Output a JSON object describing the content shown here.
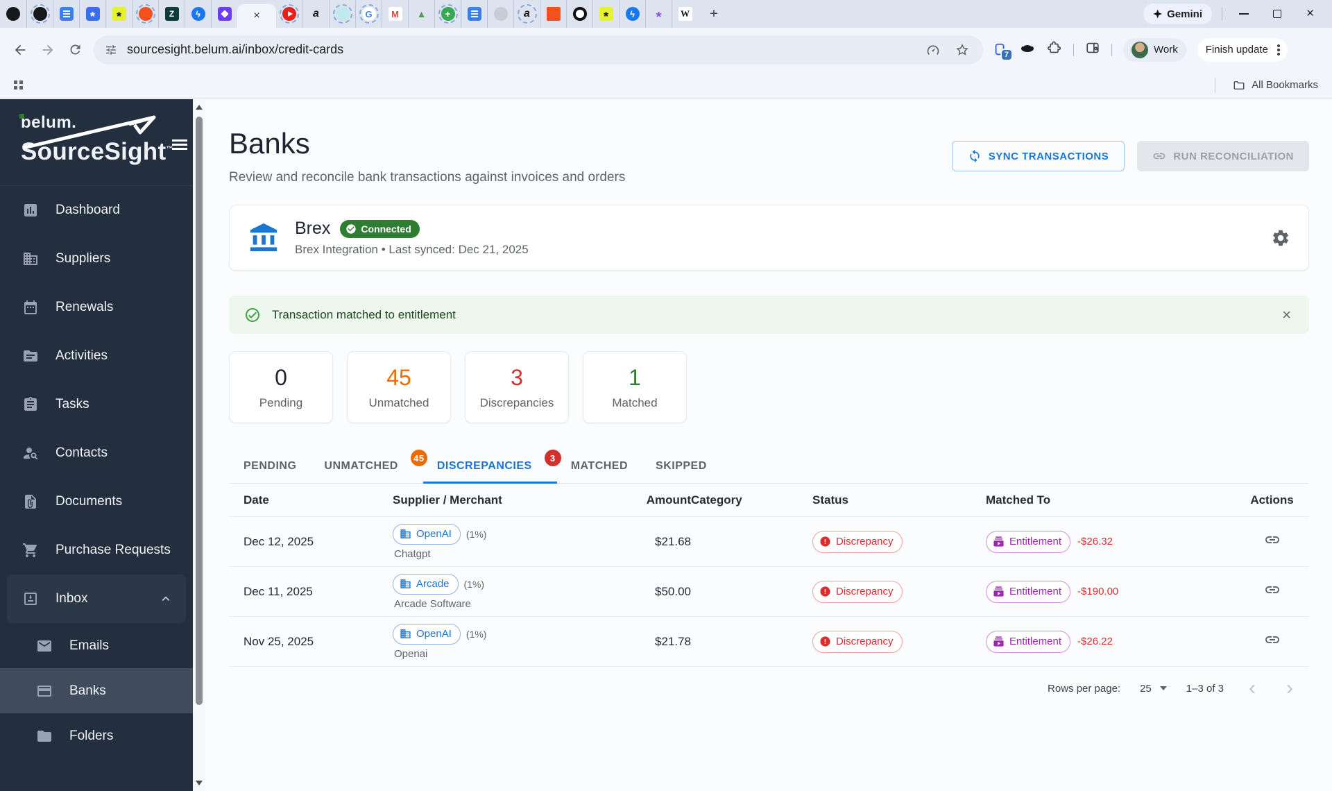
{
  "theme": {
    "accent": "#1976d2",
    "success": "#2e7d32",
    "warning": "#ed6c02",
    "error": "#d32f2f",
    "purple": "#9c27b0",
    "sidebar_bg": "#232e3e",
    "alert_bg": "#edf7ed",
    "tabstrip_bg": "#dde4f0"
  },
  "browser": {
    "url": "sourcesight.belum.ai/inbox/credit-cards",
    "gemini_label": "Gemini",
    "profile_label": "Work",
    "update_button": "Finish update",
    "extension_badge": "7",
    "bookmarks_label": "All Bookmarks"
  },
  "sidebar": {
    "brand_line1": "belum.",
    "brand_line2": "SourceSight",
    "brand_tm": "™",
    "items": [
      {
        "label": "Dashboard"
      },
      {
        "label": "Suppliers"
      },
      {
        "label": "Renewals"
      },
      {
        "label": "Activities"
      },
      {
        "label": "Tasks"
      },
      {
        "label": "Contacts"
      },
      {
        "label": "Documents"
      },
      {
        "label": "Purchase Requests"
      },
      {
        "label": "Inbox"
      },
      {
        "label": "Emails"
      },
      {
        "label": "Banks"
      },
      {
        "label": "Folders"
      }
    ]
  },
  "page": {
    "title": "Banks",
    "subtitle": "Review and reconcile bank transactions against invoices and orders",
    "sync_button": "SYNC TRANSACTIONS",
    "reconcile_button": "RUN RECONCILIATION"
  },
  "integration": {
    "name": "Brex",
    "status": "Connected",
    "detail": "Brex Integration • Last synced: Dec 21, 2025"
  },
  "alert": {
    "message": "Transaction matched to entitlement"
  },
  "stats": [
    {
      "value": "0",
      "label": "Pending"
    },
    {
      "value": "45",
      "label": "Unmatched"
    },
    {
      "value": "3",
      "label": "Discrepancies"
    },
    {
      "value": "1",
      "label": "Matched"
    }
  ],
  "tabs": [
    {
      "label": "PENDING"
    },
    {
      "label": "UNMATCHED",
      "badge": "45"
    },
    {
      "label": "DISCREPANCIES",
      "badge": "3"
    },
    {
      "label": "MATCHED"
    },
    {
      "label": "SKIPPED"
    }
  ],
  "table": {
    "columns": [
      "Date",
      "Supplier / Merchant",
      "Amount",
      "Category",
      "Status",
      "Matched To",
      "Actions"
    ],
    "rows": [
      {
        "date": "Dec 12, 2025",
        "supplier": "OpenAI",
        "confidence": "(1%)",
        "merchant": "Chatgpt",
        "amount": "$21.68",
        "category": "",
        "status": "Discrepancy",
        "matched_to": "Entitlement",
        "delta": "-$26.32"
      },
      {
        "date": "Dec 11, 2025",
        "supplier": "Arcade",
        "confidence": "(1%)",
        "merchant": "Arcade Software",
        "amount": "$50.00",
        "category": "",
        "status": "Discrepancy",
        "matched_to": "Entitlement",
        "delta": "-$190.00"
      },
      {
        "date": "Nov 25, 2025",
        "supplier": "OpenAI",
        "confidence": "(1%)",
        "merchant": "Openai",
        "amount": "$21.78",
        "category": "",
        "status": "Discrepancy",
        "matched_to": "Entitlement",
        "delta": "-$26.22"
      }
    ]
  },
  "pagination": {
    "rows_per_page_label": "Rows per page:",
    "rows_per_page": "25",
    "range": "1–3 of 3"
  }
}
